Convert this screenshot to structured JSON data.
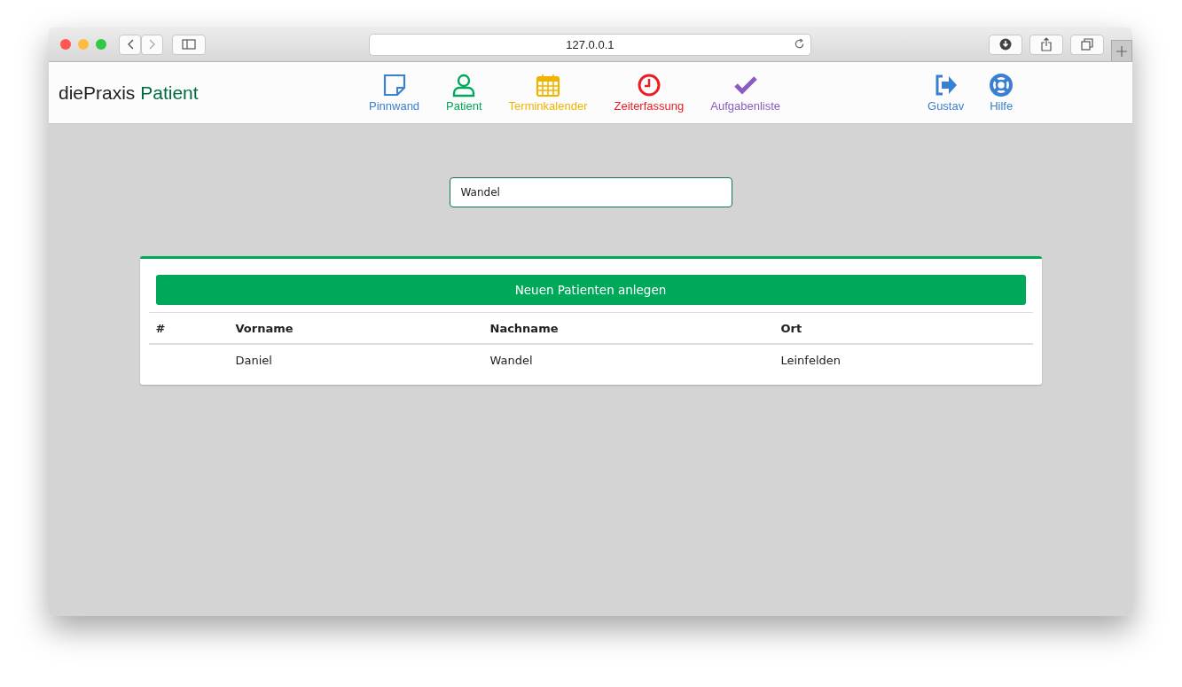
{
  "browser": {
    "address": "127.0.0.1"
  },
  "brand": {
    "name": "diePraxis",
    "section": "Patient"
  },
  "nav": [
    {
      "kind": "note",
      "label": "Pinnwand",
      "color": "#3a7fd0"
    },
    {
      "kind": "person",
      "label": "Patient",
      "color": "#00a85a"
    },
    {
      "kind": "calendar",
      "label": "Terminkalender",
      "color": "#f0b400"
    },
    {
      "kind": "clock",
      "label": "Zeiterfassung",
      "color": "#ee1c25"
    },
    {
      "kind": "check",
      "label": "Aufgabenliste",
      "color": "#8a5cc2"
    }
  ],
  "user_nav": [
    {
      "kind": "logout",
      "label": "Gustav",
      "color": "#3a7fd0"
    },
    {
      "kind": "help",
      "label": "Hilfe",
      "color": "#3a7fd0"
    }
  ],
  "search": {
    "value": "Wandel"
  },
  "new_button": "Neuen Patienten anlegen",
  "table": {
    "columns": [
      "#",
      "Vorname",
      "Nachname",
      "Ort"
    ],
    "rows": [
      [
        "",
        "Daniel",
        "Wandel",
        "Leinfelden"
      ]
    ]
  }
}
